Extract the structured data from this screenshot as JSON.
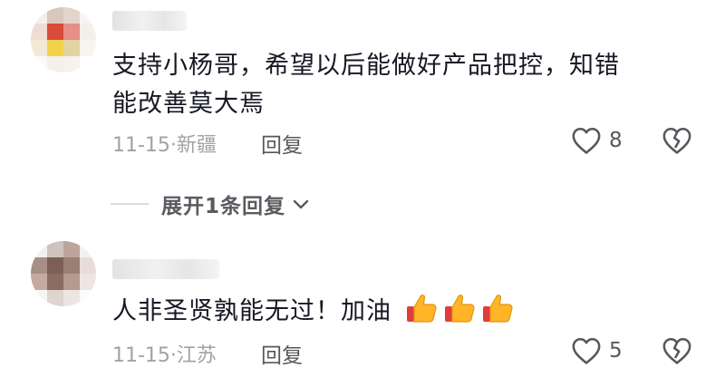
{
  "comments": [
    {
      "text_line1": "支持小杨哥，希望以后能做好产品把控，知错",
      "text_line2": "能改善莫大焉",
      "date_location": "11-15·新疆",
      "reply_label": "回复",
      "like_count": "8"
    },
    {
      "text": "人非圣贤孰能无过！加油",
      "date_location": "11-15·江苏",
      "reply_label": "回复",
      "like_count": "5",
      "emoji": [
        "thumbs-up",
        "thumbs-up",
        "thumbs-up"
      ]
    }
  ],
  "expand_replies": {
    "label": "展开1条回复"
  },
  "colors": {
    "text": "#161823",
    "meta": "#a1a2a7",
    "icon": "#57585e",
    "thumb": "#ffb525"
  }
}
